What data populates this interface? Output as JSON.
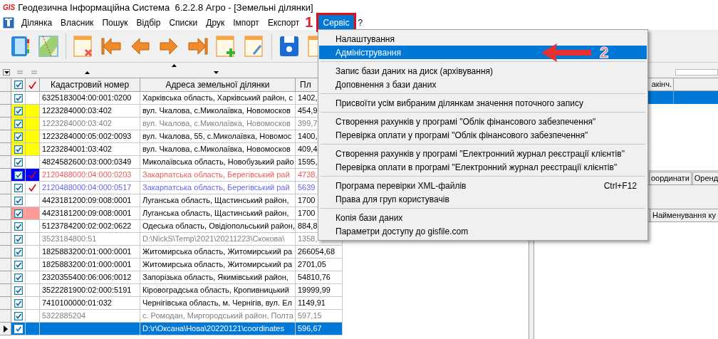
{
  "window": {
    "logo": "GIS",
    "title": "Геодезична Інформаційна Система  6.2.2.8 Агро - [Земельні ділянки]"
  },
  "menu_bar": [
    {
      "label": "Ділянка",
      "selected": false
    },
    {
      "label": "Власник",
      "selected": false
    },
    {
      "label": "Пошук",
      "selected": false
    },
    {
      "label": "Відбір",
      "selected": false
    },
    {
      "label": "Списки",
      "selected": false
    },
    {
      "label": "Друк",
      "selected": false
    },
    {
      "label": "Імпорт",
      "selected": false
    },
    {
      "label": "Експорт",
      "selected": false
    },
    {
      "label": "Сервіс",
      "selected": true
    },
    {
      "label": "?",
      "selected": false
    }
  ],
  "annotations": [
    {
      "kind": "number",
      "text": "1"
    },
    {
      "kind": "arrow",
      "text": "2"
    }
  ],
  "menu": [
    {
      "kind": "item",
      "label": "Налаштування",
      "selected": false
    },
    {
      "kind": "item",
      "label": "Адміністрування",
      "selected": true
    },
    {
      "kind": "separator"
    },
    {
      "kind": "item",
      "label": "Запис бази даних на диск (архівування)",
      "selected": false
    },
    {
      "kind": "item",
      "label": "Доповнення з бази даних",
      "selected": false
    },
    {
      "kind": "separator"
    },
    {
      "kind": "item",
      "label": "Присвоїти усім вибраним ділянкам значення поточного запису",
      "selected": false
    },
    {
      "kind": "separator"
    },
    {
      "kind": "item",
      "label": "Створення рахунків у програмі \"Облік фінансового забезпечення\"",
      "selected": false
    },
    {
      "kind": "item",
      "label": "Перевірка оплати у програмі \"Облік фінансового забезпечення\"",
      "selected": false
    },
    {
      "kind": "separator"
    },
    {
      "kind": "item",
      "label": "Створення рахунків у програмі \"Електронний журнал реєстрації клієнтів\"",
      "selected": false
    },
    {
      "kind": "item",
      "label": "Перевірка оплати в програмі \"Електронний журнал реєстрації клієнтів\"",
      "selected": false
    },
    {
      "kind": "separator"
    },
    {
      "kind": "item",
      "label": "Програма перевірки XML-файлів",
      "shortcut": "Ctrl+F12",
      "selected": false
    },
    {
      "kind": "item",
      "label": "Права для груп користувачів",
      "selected": false
    },
    {
      "kind": "separator"
    },
    {
      "kind": "item",
      "label": "Копія бази даних",
      "selected": false
    },
    {
      "kind": "item",
      "label": "Параметри доступу до gisfile.com",
      "selected": false
    }
  ],
  "table": {
    "columns": [
      "Кадастровий номер",
      "Адреса земельної ділянки",
      "Пл"
    ],
    "rows": [
      {
        "cadastral": "6325183004:00:001:0200",
        "address": "Харківська область, Харківський район, с",
        "area": "1402,",
        "checked": true,
        "tick": false,
        "kind": "normal",
        "selected": false
      },
      {
        "cadastral": "1223284000:03:402",
        "address": "вул. Чкалова, с.Миколаївка, Новомосков",
        "area": "454,9",
        "checked": true,
        "tick": false,
        "kind": "normal",
        "color": "#ffff00",
        "selected": false
      },
      {
        "cadastral": "1223284000:03:402",
        "address": "вул. Чкалова, с.Миколаївка, Новомосков",
        "area": "399,7",
        "checked": true,
        "tick": false,
        "kind": "grey",
        "color": "#ffff00",
        "selected": false
      },
      {
        "cadastral": "1223284000:05:002:0093",
        "address": "вул. Чкалова, 55, с.Миколаївка, Новомос",
        "area": "1400,",
        "checked": true,
        "tick": false,
        "kind": "normal",
        "color": "#ffff00",
        "selected": false
      },
      {
        "cadastral": "1223284001:03:402",
        "address": "вул. Чкалова, с.Миколаївка, Новомосков",
        "area": "409,4",
        "checked": true,
        "tick": false,
        "kind": "normal",
        "color": "#ffff00",
        "selected": false
      },
      {
        "cadastral": "4824582600:03:000:0349",
        "address": "Миколаївська область, Новобузький райо",
        "area": "1595,",
        "checked": true,
        "tick": false,
        "kind": "normal",
        "selected": false
      },
      {
        "cadastral": "2120488000:04:000:0203",
        "address": "Закарпатська область, Берегівський рай",
        "area": "4738,",
        "checked": true,
        "tick": true,
        "kind": "red",
        "color": "#0000ff",
        "selected": false
      },
      {
        "cadastral": "2120488000:04:000:0517",
        "address": "Закарпатська область, Берегівський рай",
        "area": "5639",
        "checked": true,
        "tick": true,
        "kind": "blue",
        "selected": false
      },
      {
        "cadastral": "4423181200:09:008:0001",
        "address": "Луганська область, Щастинський район,",
        "area": "1700",
        "checked": true,
        "tick": false,
        "kind": "normal",
        "selected": false
      },
      {
        "cadastral": "4423181200:09:008:0001",
        "address": "Луганська область, Щастинський район,",
        "area": "1700",
        "checked": true,
        "tick": false,
        "kind": "normal",
        "color": "#ff9999",
        "selected": false
      },
      {
        "cadastral": "5123784200:02:002:0622",
        "address": "Одеська область, Овідіопольський район,",
        "area": "884,8",
        "checked": true,
        "tick": false,
        "kind": "normal",
        "selected": false
      },
      {
        "cadastral": "3523184800:51",
        "address": "D:\\NickS\\Temp\\2021\\20211223\\Скокова\\",
        "area": "1358,",
        "checked": true,
        "tick": false,
        "kind": "grey",
        "selected": false
      },
      {
        "cadastral": "1825883200:01:000:0001",
        "address": "Житомирська область, Житомирський ра",
        "area": "266054,68",
        "checked": true,
        "tick": false,
        "kind": "normal",
        "selected": false
      },
      {
        "cadastral": "1825883200:01:000:0001",
        "address": "Житомирська область, Житомирський ра",
        "area": "2701,05",
        "checked": true,
        "tick": false,
        "kind": "normal",
        "selected": false
      },
      {
        "cadastral": "2320355400:06:006:0012",
        "address": "Запорізька область, Якимівський район,",
        "area": "54810,76",
        "checked": true,
        "tick": false,
        "kind": "normal",
        "selected": false
      },
      {
        "cadastral": "3522281900:02:000:5191",
        "address": "Кіровоградська область, Кропивницький",
        "area": "19999,99",
        "checked": true,
        "tick": false,
        "kind": "normal",
        "selected": false
      },
      {
        "cadastral": "7410100000:01:032",
        "address": "Чернігівська область, м. Чернігів, вул. Ел",
        "area": "1149,91",
        "checked": true,
        "tick": false,
        "kind": "normal",
        "selected": false
      },
      {
        "cadastral": "5322885204",
        "address": "с. Ромодан, Миргородський район, Полта",
        "area": "597,15",
        "checked": true,
        "tick": false,
        "kind": "grey",
        "selected": false
      },
      {
        "address": "D:\\r\\Оксана\\Нова\\20220121\\coordinates",
        "area": "596,67",
        "checked": true,
        "tick": false,
        "selected": true
      }
    ]
  },
  "right_panel": {
    "column": "акінч.",
    "tabs": [
      {
        "label": "оординати",
        "selected": false
      },
      {
        "label": "Оренд",
        "selected": false
      }
    ],
    "lower_column": "Найменування ку"
  }
}
